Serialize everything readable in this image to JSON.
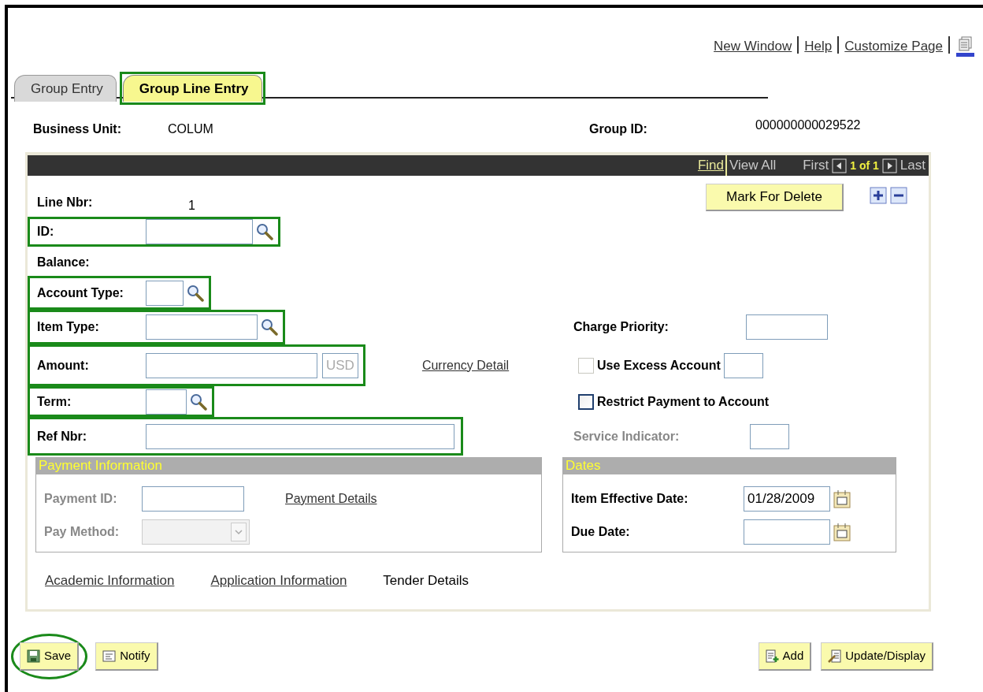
{
  "header_links": [
    {
      "label": "New Window"
    },
    {
      "label": "Help"
    },
    {
      "label": "Customize Page"
    }
  ],
  "tabs": [
    {
      "label": "Group Entry",
      "selected": false,
      "highlighted": false
    },
    {
      "label": "Group Line Entry",
      "selected": true,
      "highlighted": true
    }
  ],
  "header_fields": [
    {
      "label": "Business Unit:",
      "value": "COLUM"
    },
    {
      "label": "Group ID:",
      "value": "000000000029522"
    }
  ],
  "grid_bar": {
    "find": "Find",
    "view_all": "View All",
    "first": "First",
    "counter": "1 of 1",
    "last": "Last"
  },
  "line_nbr": {
    "label": "Line Nbr:",
    "value": "1"
  },
  "mark_for_delete": "Mark For Delete",
  "fields": [
    {
      "kind": "lookup",
      "label": "ID:",
      "highlighted": true
    },
    {
      "kind": "heading",
      "label": "Balance:",
      "highlighted": false
    },
    {
      "kind": "lookup",
      "label": "Account Type:",
      "highlighted": true
    },
    {
      "kind": "lookup",
      "label": "Item Type:",
      "highlighted": true
    },
    {
      "kind": "currency",
      "label": "Amount:",
      "currency": "USD",
      "link": "Currency Detail",
      "highlighted": true
    },
    {
      "kind": "lookup",
      "label": "Term:",
      "highlighted": true
    },
    {
      "kind": "text",
      "label": "Ref Nbr:",
      "highlighted": true
    }
  ],
  "side_fields": [
    {
      "kind": "field",
      "label": "Charge Priority:",
      "disabled": false
    },
    {
      "kind": "checkbox",
      "label": "Use Excess Account",
      "checked": false,
      "disabled": true
    },
    {
      "kind": "checkbox",
      "label": "Restrict Payment to Account",
      "checked": false,
      "disabled": false
    },
    {
      "kind": "field",
      "label": "Service Indicator:",
      "disabled": true
    }
  ],
  "payment_information": {
    "title": "Payment Information",
    "fields": [
      {
        "kind": "text",
        "label": "Payment ID:",
        "link": "Payment Details",
        "disabled": true
      },
      {
        "kind": "select",
        "label": "Pay Method:",
        "disabled": true
      }
    ]
  },
  "dates": {
    "title": "Dates",
    "fields": [
      {
        "label": "Item Effective Date:",
        "value": "01/28/2009"
      },
      {
        "label": "Due Date:"
      }
    ]
  },
  "bottom_links": [
    {
      "label": "Academic Information",
      "selected": false
    },
    {
      "label": "Application Information",
      "selected": false
    },
    {
      "label": "Tender Details",
      "selected": true
    }
  ],
  "buttons": [
    {
      "kind": "save",
      "label": "Save",
      "highlighted": true
    },
    {
      "kind": "notify",
      "label": "Notify",
      "highlighted": false
    },
    {
      "kind": "add",
      "label": "Add",
      "highlighted": false
    },
    {
      "kind": "update",
      "label": "Update/Display",
      "highlighted": false
    }
  ]
}
